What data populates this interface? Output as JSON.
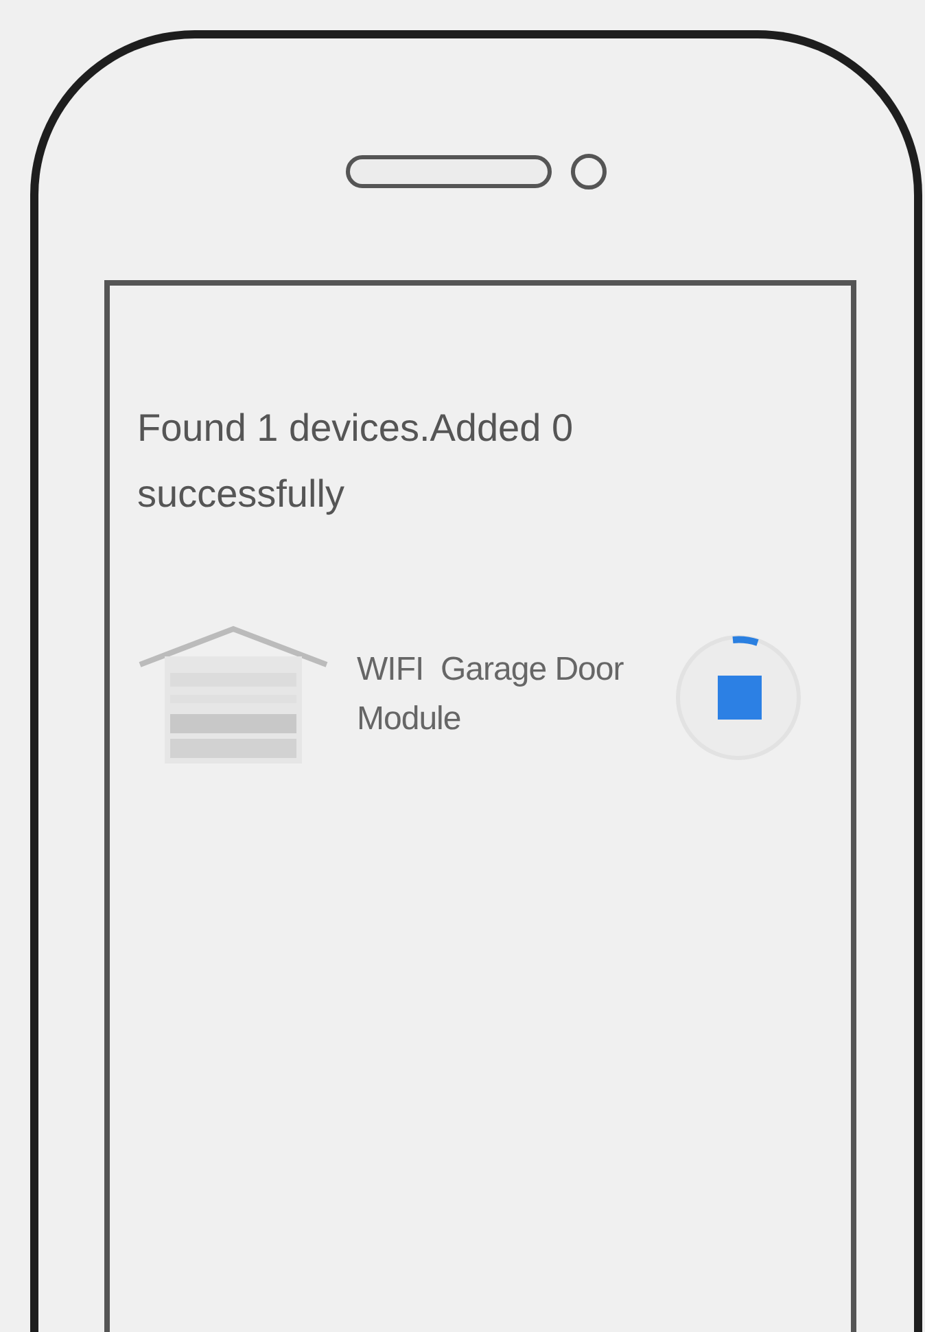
{
  "screen": {
    "status_message": "Found 1 devices.Added 0 successfully",
    "devices": [
      {
        "name": "WIFI  Garage Door Module"
      }
    ]
  }
}
